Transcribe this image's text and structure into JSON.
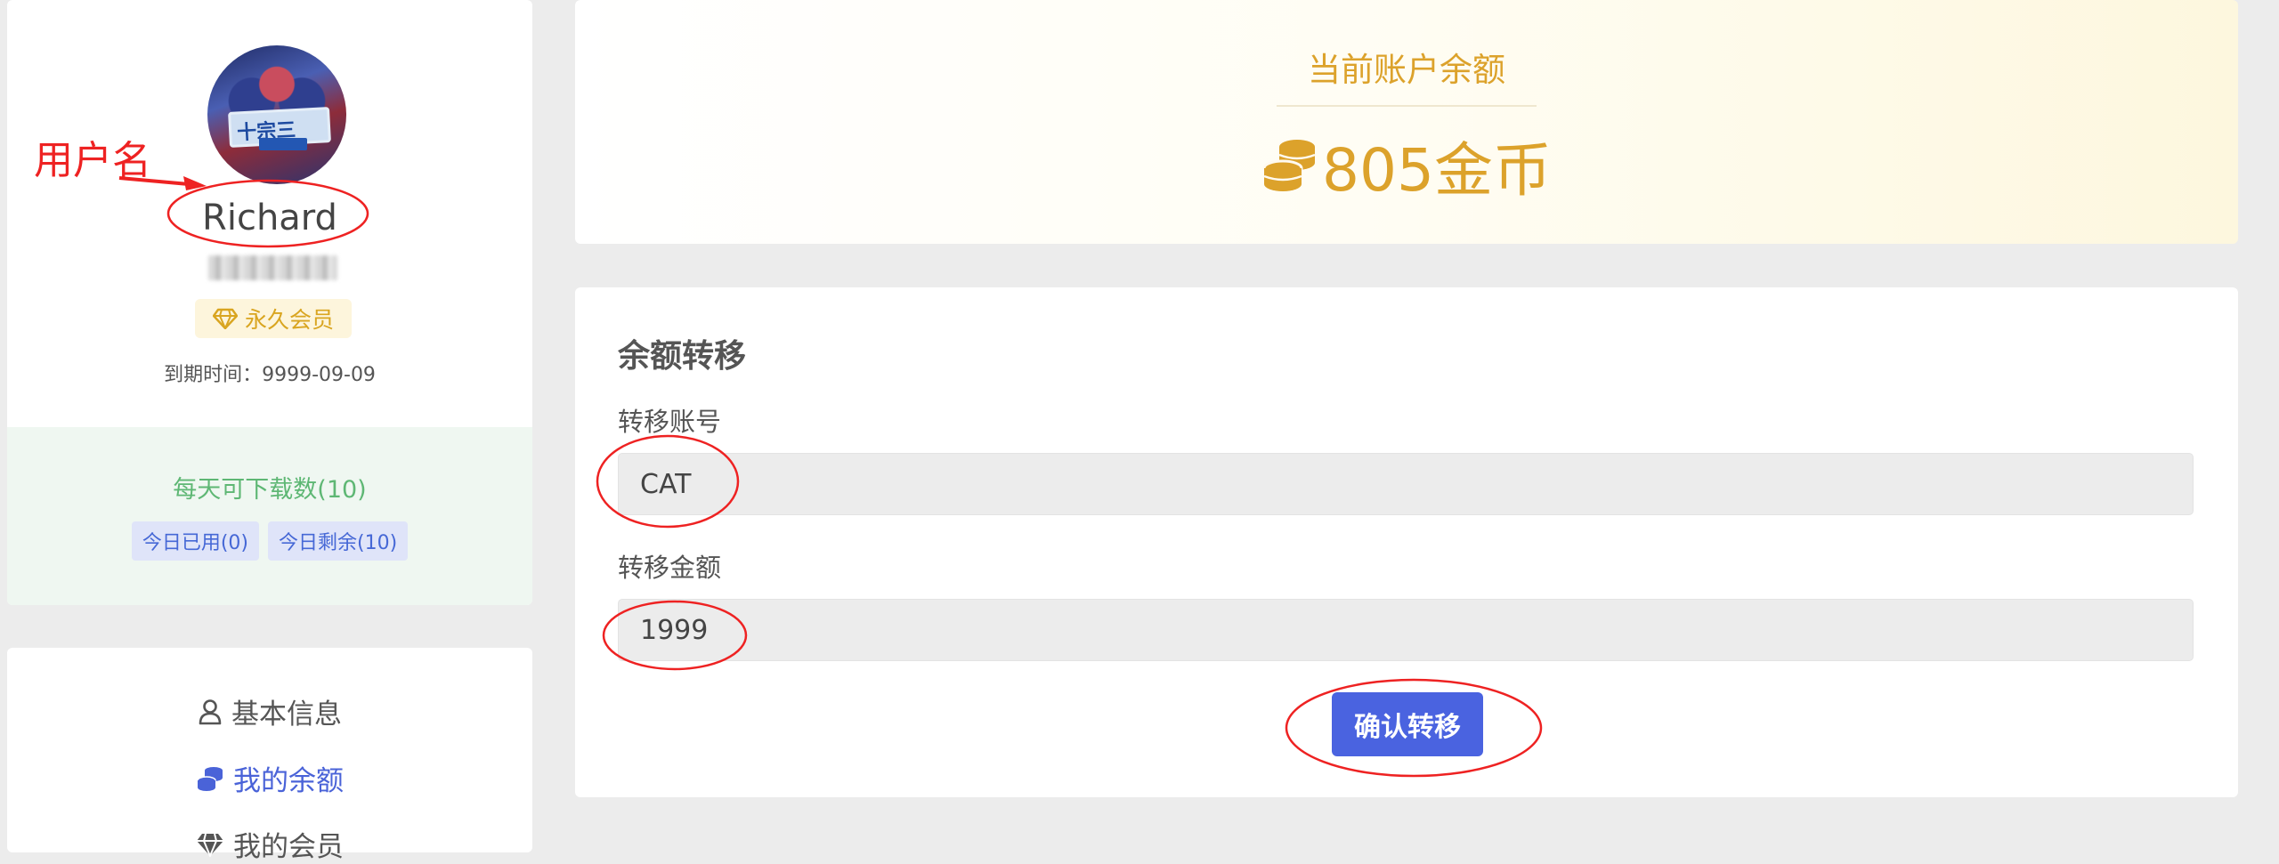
{
  "profile": {
    "username": "Richard",
    "vip_label": "永久会员",
    "expire_label": "到期时间：",
    "expire_date": "9999-09-09",
    "avatar_badge_text": "十宗三"
  },
  "downloads": {
    "title": "每天可下载数(10)",
    "used": "今日已用(0)",
    "remaining": "今日剩余(10)"
  },
  "nav": {
    "items": [
      {
        "label": "基本信息",
        "icon": "user-icon"
      },
      {
        "label": "我的余额",
        "icon": "coins-icon"
      },
      {
        "label": "我的会员",
        "icon": "diamond-icon"
      }
    ]
  },
  "balance": {
    "title": "当前账户余额",
    "amount": "805金币"
  },
  "transfer": {
    "title": "余额转移",
    "account_label": "转移账号",
    "account_value": "CAT",
    "amount_label": "转移金额",
    "amount_value": "1999",
    "confirm_label": "确认转移"
  },
  "annotation": {
    "label": "用户名"
  },
  "colors": {
    "accent_blue": "#4a63e0",
    "gold": "#dca22b",
    "green": "#5eb774",
    "annotation_red": "#ee2222"
  }
}
